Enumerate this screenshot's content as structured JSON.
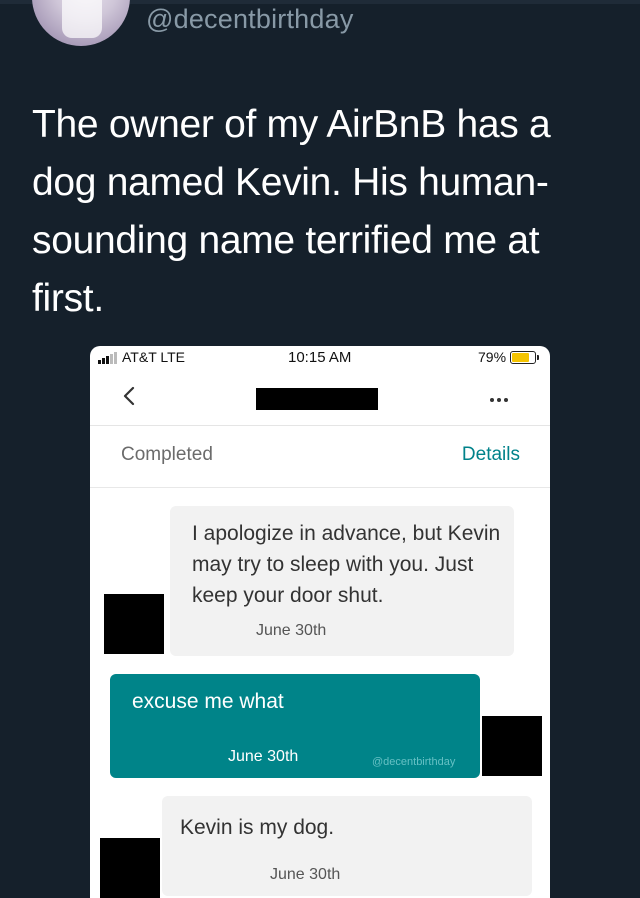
{
  "tweet": {
    "handle": "@decentbirthday",
    "text": "The owner of my AirBnB has a dog named Kevin. His human-sounding name terrified me at first."
  },
  "phone": {
    "status_bar": {
      "carrier": "AT&T  LTE",
      "time": "10:15 AM",
      "battery": "79%",
      "battery_level": 0.79,
      "battery_color": "#f5c400"
    },
    "nav": {
      "back_icon": "chevron-left-icon",
      "more_icon": "ellipsis-icon"
    },
    "reservation": {
      "status": "Completed",
      "details_link": "Details",
      "accent_color": "#00828a"
    },
    "messages": [
      {
        "sender": "host",
        "text": "I apologize in advance, but Kevin may try to sleep with you. Just keep your door shut.",
        "date": "June 30th"
      },
      {
        "sender": "guest",
        "text": "excuse me what",
        "date": "June 30th",
        "color": "#008489"
      },
      {
        "sender": "host",
        "text": "Kevin is my dog.",
        "date": "June 30th"
      }
    ],
    "watermark": "@decentbirthday"
  }
}
